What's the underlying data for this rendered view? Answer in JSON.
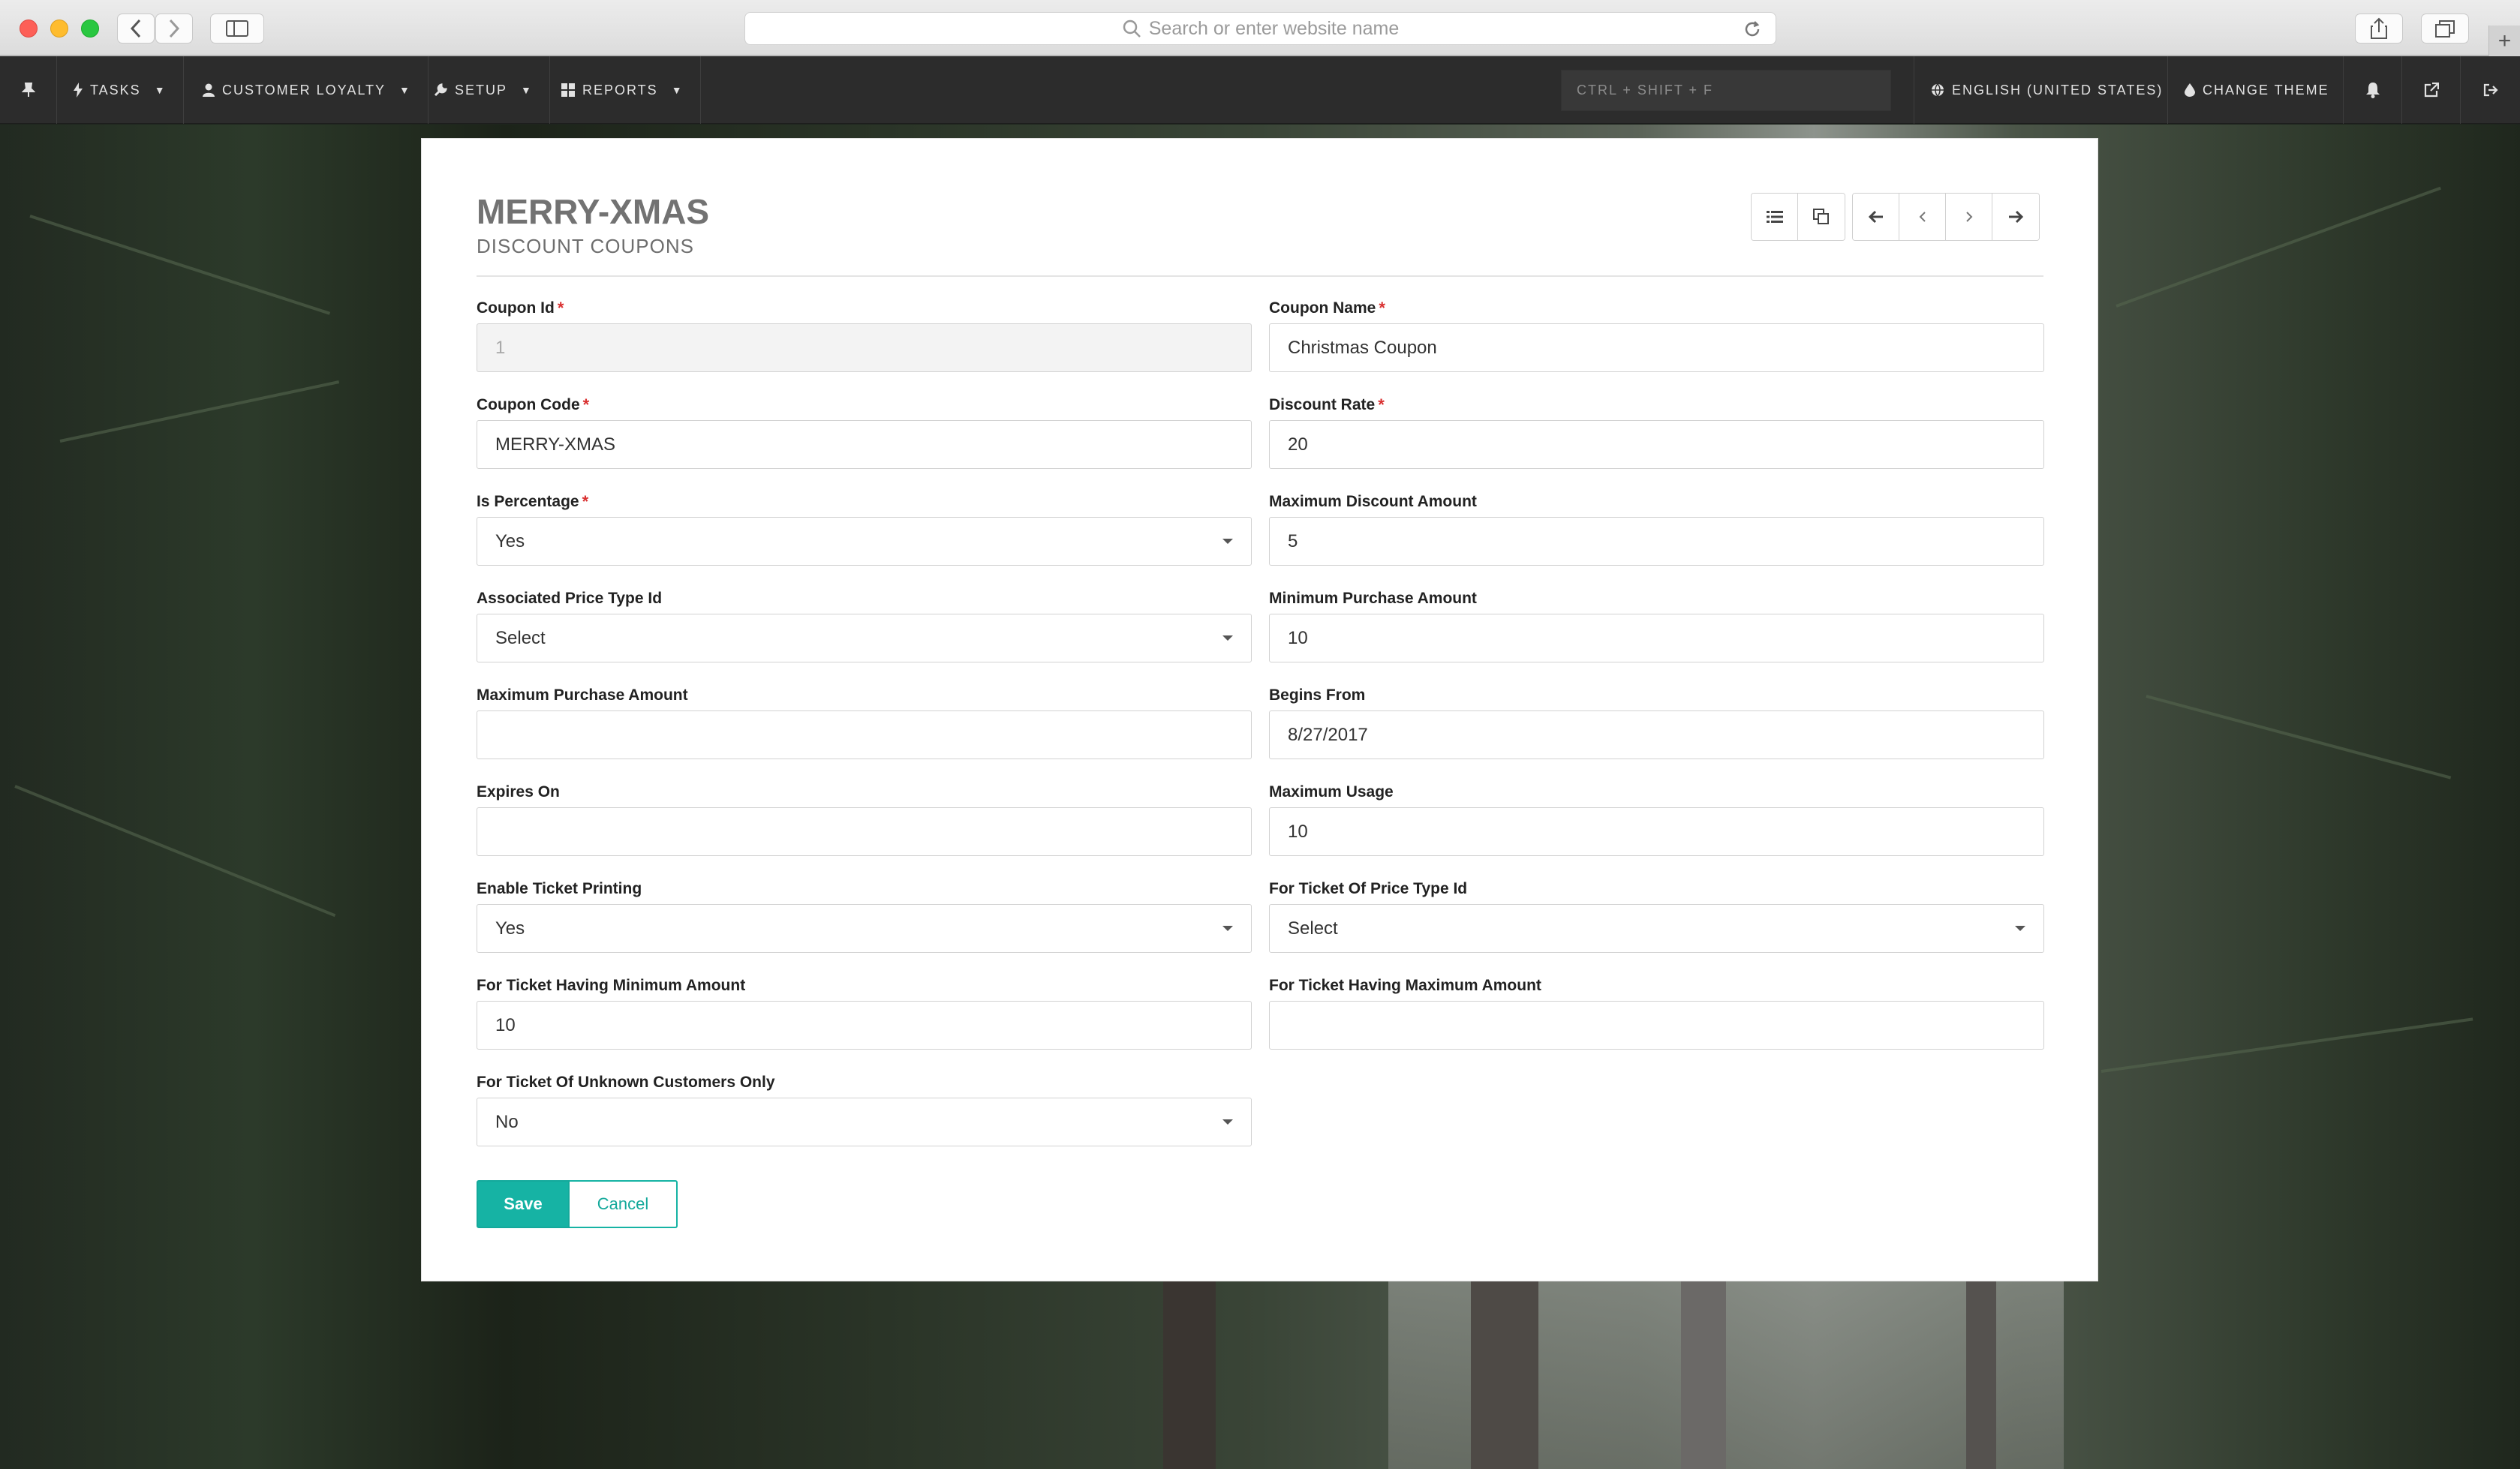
{
  "browser": {
    "url_placeholder": "Search or enter website name",
    "new_tab": "+"
  },
  "navbar": {
    "items": [
      {
        "label": "Tasks",
        "icon": "bolt-icon"
      },
      {
        "label": "Customer Loyalty",
        "icon": "user-icon"
      },
      {
        "label": "Setup",
        "icon": "wrench-icon"
      },
      {
        "label": "Reports",
        "icon": "grid-icon"
      }
    ],
    "search_placeholder": "CTRL + SHIFT + F",
    "language": "English (United States)",
    "change_theme": "Change Theme"
  },
  "page": {
    "title": "MERRY-XMAS",
    "subtitle": "Discount Coupons"
  },
  "form": {
    "coupon_id": {
      "label": "Coupon Id",
      "value": "1"
    },
    "coupon_name": {
      "label": "Coupon Name",
      "value": "Christmas Coupon"
    },
    "coupon_code": {
      "label": "Coupon Code",
      "value": "MERRY-XMAS"
    },
    "discount_rate": {
      "label": "Discount Rate",
      "value": "20"
    },
    "is_percentage": {
      "label": "Is Percentage",
      "value": "Yes"
    },
    "maximum_discount_amount": {
      "label": "Maximum Discount Amount",
      "value": "5"
    },
    "associated_price_type_id": {
      "label": "Associated Price Type Id",
      "value": "Select"
    },
    "minimum_purchase_amount": {
      "label": "Minimum Purchase Amount",
      "value": "10"
    },
    "maximum_purchase_amount": {
      "label": "Maximum Purchase Amount",
      "value": ""
    },
    "begins_from": {
      "label": "Begins From",
      "value": "8/27/2017"
    },
    "expires_on": {
      "label": "Expires On",
      "value": ""
    },
    "maximum_usage": {
      "label": "Maximum Usage",
      "value": "10"
    },
    "enable_ticket_printing": {
      "label": "Enable Ticket Printing",
      "value": "Yes"
    },
    "for_ticket_of_price_type_id": {
      "label": "For Ticket Of Price Type Id",
      "value": "Select"
    },
    "for_ticket_having_minimum_amount": {
      "label": "For Ticket Having Minimum Amount",
      "value": "10"
    },
    "for_ticket_having_maximum_amount": {
      "label": "For Ticket Having Maximum Amount",
      "value": ""
    },
    "for_ticket_of_unknown_customers_only": {
      "label": "For Ticket Of Unknown Customers Only",
      "value": "No"
    },
    "required_mark": "*"
  },
  "actions": {
    "save": "Save",
    "cancel": "Cancel"
  },
  "colors": {
    "accent": "#16b3a4",
    "navbar": "#2c2c2c",
    "required": "#d93030"
  }
}
